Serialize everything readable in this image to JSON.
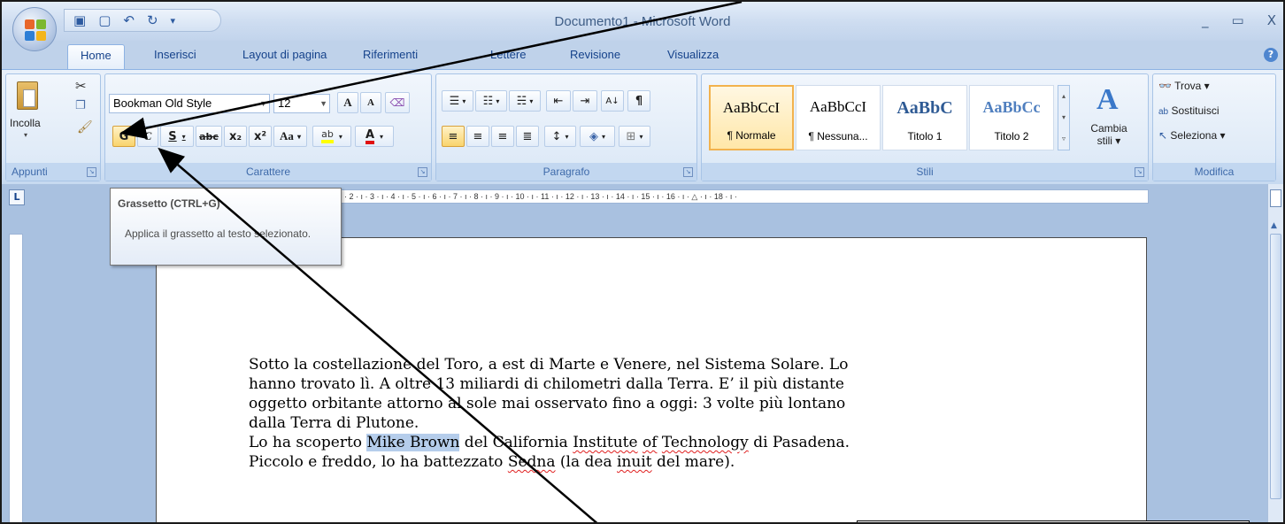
{
  "window": {
    "title": "Documento1 - Microsoft Word",
    "controls": [
      "_",
      "▭",
      "X"
    ]
  },
  "quick_access": [
    "save-icon",
    "new-icon",
    "undo-icon",
    "redo-icon"
  ],
  "tabs": [
    "Home",
    "Inserisci",
    "Layout di pagina",
    "Riferimenti",
    "Lettere",
    "Revisione",
    "Visualizza"
  ],
  "groups": {
    "appunti": {
      "label": "Appunti",
      "paste": "Incolla"
    },
    "carattere": {
      "label": "Carattere",
      "font": "Bookman Old Style",
      "size": "12",
      "bold": "G",
      "italic": "C",
      "underline": "S",
      "strike": "abc",
      "subscript": "x₂",
      "superscript": "x²",
      "case": "Aa",
      "grow": "A",
      "shrink": "A"
    },
    "paragrafo": {
      "label": "Paragrafo",
      "pilcrow": "¶"
    },
    "stili": {
      "label": "Stili",
      "tiles": [
        {
          "sample": "AaBbCcI",
          "name": "¶ Normale"
        },
        {
          "sample": "AaBbCcI",
          "name": "¶ Nessuna..."
        },
        {
          "sample": "AaBbC",
          "name": "Titolo 1"
        },
        {
          "sample": "AaBbCc",
          "name": "Titolo 2"
        }
      ],
      "change": "Cambia stili",
      "change_line2": "stili ▾",
      "change_line1": "Cambia"
    },
    "modifica": {
      "label": "Modifica",
      "find": "Trova",
      "replace": "Sostituisci",
      "select": "Seleziona"
    }
  },
  "ruler": "· 2 · ı · 3 · ı · 4 · ı · 5 · ı · 6 · ı · 7 · ı · 8 · ı · 9 · ı · 10 · ı · 11 · ı · 12 · ı · 13 · ı · 14 · ı · 15 · ı · 16 · ı · △ · ı · 18 · ı ·",
  "tooltip": {
    "title": "Grassetto (CTRL+G)",
    "body": "Applica il grassetto al testo selezionato."
  },
  "document": {
    "line1": "Sotto la costellazione del Toro, a est di Marte e Venere, nel Sistema Solare. Lo",
    "line2": "hanno trovato lì. A oltre 13 miliardi di chilometri dalla Terra. E’ il più distante",
    "line3": "oggetto orbitante attorno al sole mai osservato fino a oggi: 3 volte più lontano",
    "line4": "dalla Terra di Plutone.",
    "line5_a": "Lo ha scoperto ",
    "line5_sel": "Mike Brown",
    "line5_b": " del California ",
    "line5_w1": "Institute",
    "line5_c": " ",
    "line5_w2": "of",
    "line5_d": " ",
    "line5_w3": "Technology",
    "line5_e": " di Pasadena.",
    "line6_a": "Piccolo e freddo, lo ha battezzato ",
    "line6_w1": "Sedna",
    "line6_b": " (la dea ",
    "line6_w2": "inuit",
    "line6_c": " del mare)."
  }
}
